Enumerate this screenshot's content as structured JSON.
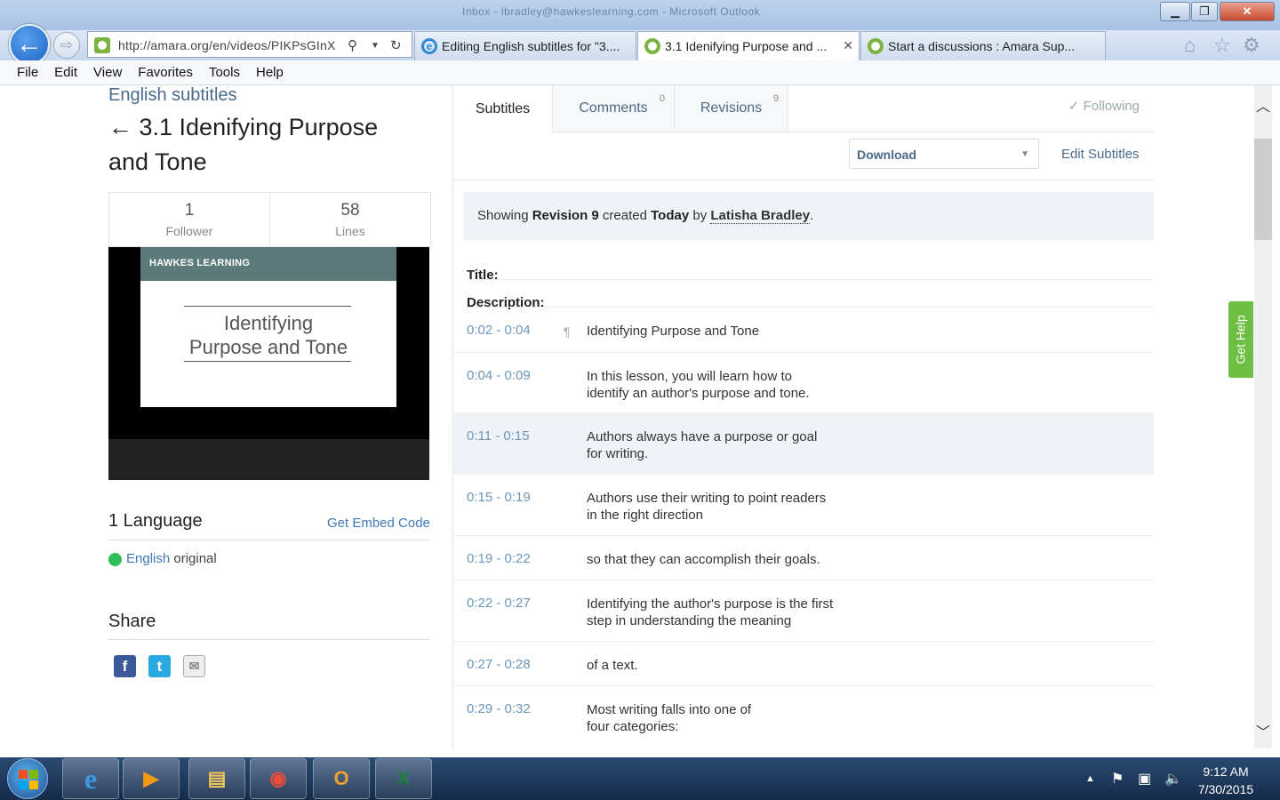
{
  "window": {
    "title": "Inbox - lbradley@hawkeslearning.com - Microsoft Outlook"
  },
  "browser": {
    "url": "http://amara.org/en/videos/PIKPsGInX",
    "tabs": [
      {
        "label": "Editing English subtitles for \"3...."
      },
      {
        "label": "3.1 Idenifying Purpose and ..."
      },
      {
        "label": "Start a discussions : Amara Sup..."
      }
    ],
    "menu": [
      "File",
      "Edit",
      "View",
      "Favorites",
      "Tools",
      "Help"
    ]
  },
  "left": {
    "language_title": "English subtitles",
    "video_title": "← 3.1 Idenifying Purpose and Tone",
    "stats": [
      {
        "num": "1",
        "label": "Follower"
      },
      {
        "num": "58",
        "label": "Lines"
      }
    ],
    "video": {
      "brand": "HAWKES LEARNING",
      "slide_line1": "Identifying",
      "slide_line2": "Purpose and Tone"
    },
    "languages_heading": "1 Language",
    "embed_link": "Get Embed Code",
    "language_name": "English",
    "language_note": " original",
    "share_heading": "Share"
  },
  "right": {
    "tabs": [
      {
        "label": "Subtitles",
        "count": ""
      },
      {
        "label": "Comments",
        "count": "0"
      },
      {
        "label": "Revisions",
        "count": "9"
      }
    ],
    "following": "✓ Following",
    "download_label": "Download",
    "edit_subtitles": "Edit Subtitles",
    "revision": {
      "prefix": "Showing ",
      "rev": "Revision 9",
      "mid": " created ",
      "when": "Today",
      "by": " by ",
      "author": "Latisha Bradley",
      "end": "."
    },
    "title_label": "Title:",
    "description_label": "Description:",
    "subtitles": [
      {
        "time": "0:02 - 0:04",
        "text": "Identifying Purpose and Tone"
      },
      {
        "time": "0:04 - 0:09",
        "text": "In this lesson, you will learn how to identify an author's purpose and tone."
      },
      {
        "time": "0:11 - 0:15",
        "text": "Authors always have a purpose or goal for writing."
      },
      {
        "time": "0:15 - 0:19",
        "text": "Authors use their writing to point readers in the right direction"
      },
      {
        "time": "0:19 - 0:22",
        "text": "so that they can accomplish their goals."
      },
      {
        "time": "0:22 - 0:27",
        "text": "Identifying the author's purpose is the first step in understanding the meaning"
      },
      {
        "time": "0:27 - 0:28",
        "text": "of a text."
      },
      {
        "time": "0:29 - 0:32",
        "text": "Most writing falls into one of four categories:"
      }
    ]
  },
  "get_help": "Get Help",
  "taskbar": {
    "time": "9:12 AM",
    "date": "7/30/2015"
  },
  "colors": {
    "link": "#3f78b5",
    "accent_green": "#6ebe44",
    "online_dot": "#2ebd59"
  }
}
